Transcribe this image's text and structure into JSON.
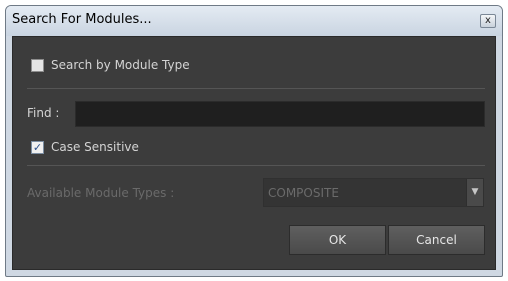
{
  "window": {
    "title": "Search For Modules...",
    "close_glyph": "x"
  },
  "search_by_type": {
    "label": "Search by Module Type",
    "checked": false
  },
  "find": {
    "label": "Find :",
    "value": ""
  },
  "case_sensitive": {
    "label": "Case Sensitive",
    "checked": true,
    "check_glyph": "✓"
  },
  "module_types": {
    "label": "Available Module Types :",
    "selected": "COMPOSITE",
    "arrow_glyph": "▼"
  },
  "buttons": {
    "ok": "OK",
    "cancel": "Cancel"
  }
}
